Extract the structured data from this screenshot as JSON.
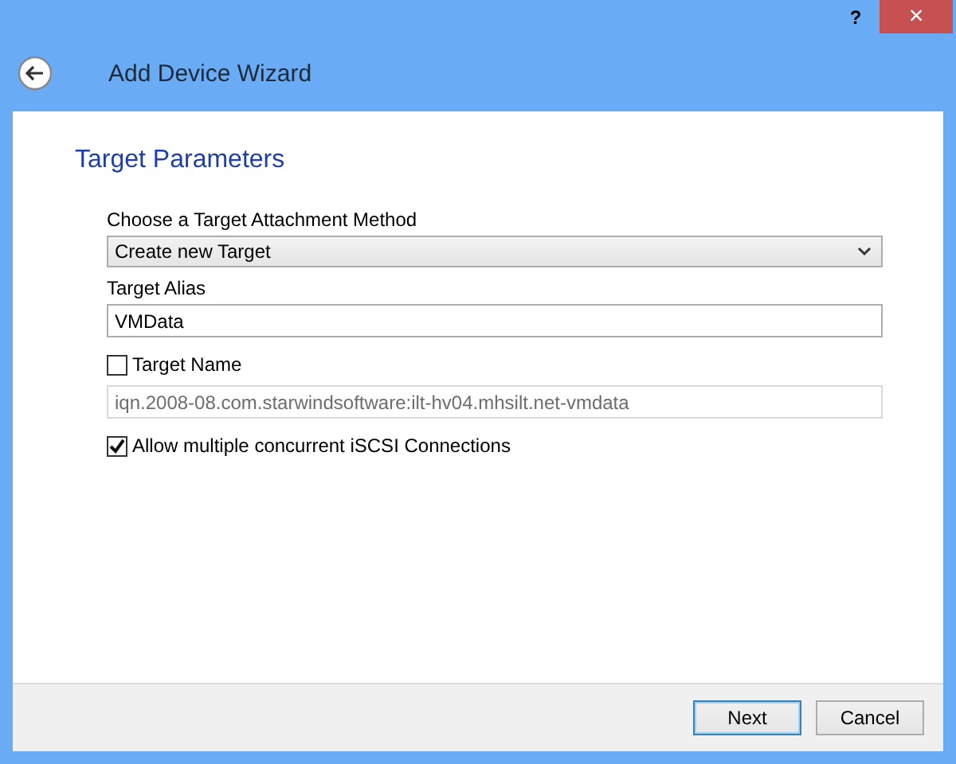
{
  "window": {
    "title_bar_buttons": [
      "?",
      "×"
    ],
    "title": "Add Device Wizard"
  },
  "page": {
    "heading": "Target Parameters",
    "fields": [
      {
        "kind": "dropdown",
        "label": "Choose a Target Attachment Method",
        "value": "Create new Target"
      },
      {
        "kind": "text",
        "label": "Target Alias",
        "value": "VMData",
        "disabled": false
      },
      {
        "kind": "checkbox",
        "label": "Target Name",
        "checked": false
      },
      {
        "kind": "text",
        "value": "iqn.2008-08.com.starwindsoftware:ilt-hv04.mhsilt.net-vmdata",
        "disabled": true
      },
      {
        "kind": "checkbox",
        "label": "Allow multiple concurrent iSCSI Connections",
        "checked": true
      }
    ]
  },
  "buttons": [
    {
      "label": "Next",
      "default": true
    },
    {
      "label": "Cancel",
      "default": false
    }
  ]
}
